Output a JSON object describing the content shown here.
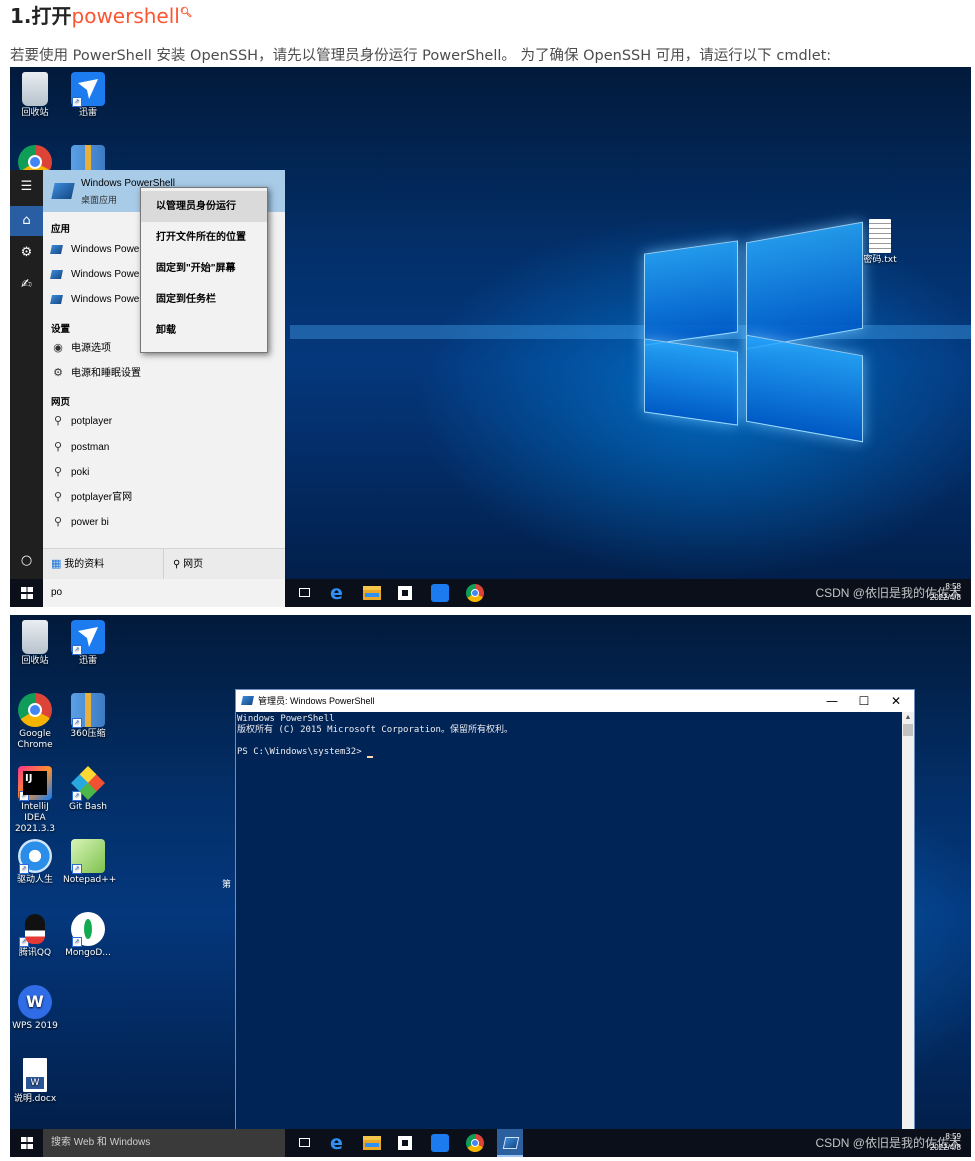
{
  "article": {
    "title_prefix": "1.打开",
    "title_link": "powershell",
    "title_link_icon": "search-icon",
    "intro": "若要使用 PowerShell 安装 OpenSSH，请先以管理员身份运行 PowerShell。 为了确保 OpenSSH 可用，请运行以下 cmdlet:"
  },
  "shot1": {
    "desktop_icons": [
      {
        "label": "回收站",
        "icon": "recycle-bin-icon"
      },
      {
        "label": "迅雷",
        "icon": "thunder-icon"
      },
      {
        "label": "",
        "icon": "chrome-icon"
      },
      {
        "label": "",
        "icon": "archive-icon"
      }
    ],
    "right_icon": {
      "label": "密码.txt",
      "icon": "text-file-icon"
    },
    "start_menu": {
      "best_match_title": "Windows PowerShell",
      "best_match_sub": "桌面应用",
      "apps_heading": "应用",
      "apps": [
        "Windows Powe",
        "Windows Powe",
        "Windows Powe"
      ],
      "settings_heading": "设置",
      "settings": [
        "电源选项",
        "电源和睡眠设置"
      ],
      "web_heading": "网页",
      "web": [
        "potplayer",
        "postman",
        "poki",
        "potplayer官网",
        "power bi"
      ],
      "bottom_left": "我的资料",
      "bottom_right": "网页"
    },
    "context_menu": [
      "以管理员身份运行",
      "打开文件所在的位置",
      "固定到\"开始\"屏幕",
      "固定到任务栏",
      "卸载"
    ],
    "search_text": "po",
    "clock_time": "8:58",
    "clock_date": "2022/4/8",
    "watermark": "CSDN @依旧是我的佐佐木"
  },
  "shot2": {
    "desktop_icons": [
      {
        "label": "回收站",
        "icon": "recycle-bin-icon"
      },
      {
        "label": "迅雷",
        "icon": "thunder-icon"
      },
      {
        "label": "Google Chrome",
        "icon": "chrome-icon"
      },
      {
        "label": "360压缩",
        "icon": "archive-icon"
      },
      {
        "label": "IntelliJ IDEA 2021.3.3",
        "icon": "intellij-icon"
      },
      {
        "label": "Git Bash",
        "icon": "git-icon"
      },
      {
        "label": "驱动人生",
        "icon": "driver-icon"
      },
      {
        "label": "Notepad++",
        "icon": "notepad-icon"
      },
      {
        "label": "腾讯QQ",
        "icon": "qq-icon"
      },
      {
        "label": "MongoD...",
        "icon": "mongodb-icon"
      },
      {
        "label": "WPS 2019",
        "icon": "wps-icon"
      },
      {
        "label": "说明.docx",
        "icon": "word-doc-icon"
      }
    ],
    "side_text": "第",
    "powershell": {
      "title": "管理员: Windows PowerShell",
      "line1": "Windows PowerShell",
      "line2": "版权所有 (C) 2015 Microsoft Corporation。保留所有权利。",
      "prompt": "PS C:\\Windows\\system32> "
    },
    "search_placeholder": "搜索 Web 和 Windows",
    "clock_time": "8:59",
    "clock_date": "2022/4/8",
    "watermark": "CSDN @依旧是我的佐佐木"
  }
}
